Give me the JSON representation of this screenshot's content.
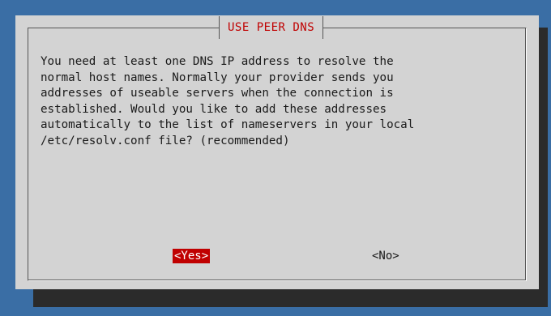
{
  "dialog": {
    "title": "USE PEER DNS",
    "message": "You need at least one DNS IP address to resolve the\nnormal host names. Normally your provider sends you\naddresses of useable servers when the connection is\nestablished. Would you like to add these addresses\nautomatically to the list of nameservers in your local\n/etc/resolv.conf file? (recommended)"
  },
  "buttons": {
    "yes_label": "<Yes>",
    "no_label": "<No>",
    "selected": "yes"
  },
  "colors": {
    "background": "#3a6ea5",
    "dialog": "#d3d3d3",
    "title": "#c00000",
    "selected_button_bg": "#c00000",
    "selected_button_fg": "#ffffff"
  }
}
